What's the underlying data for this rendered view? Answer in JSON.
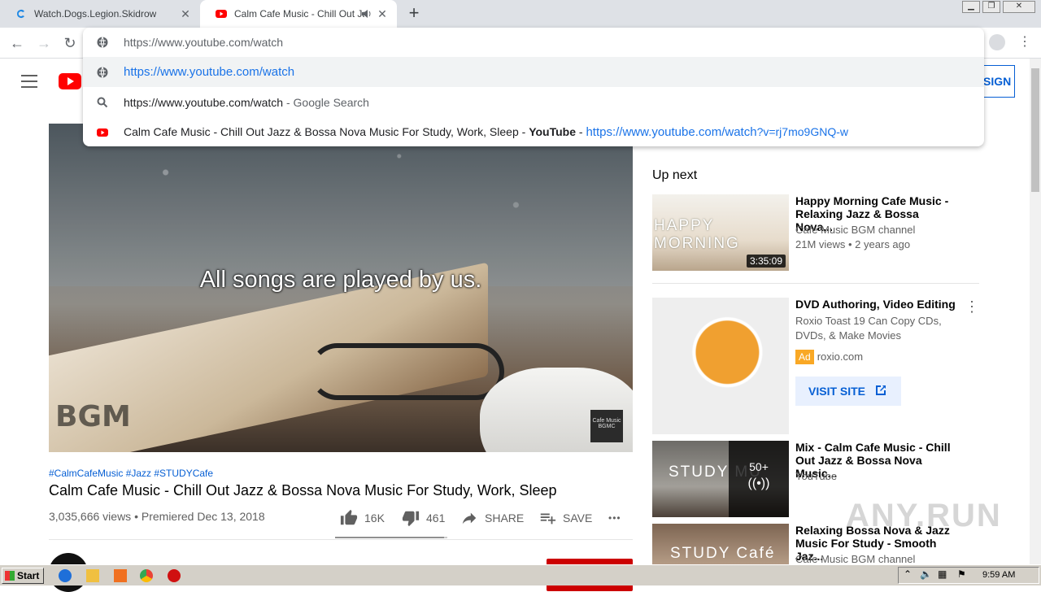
{
  "browser": {
    "tabs": [
      {
        "label": "Watch.Dogs.Legion.Skidrow",
        "favicon": "edge-download-icon"
      },
      {
        "label": "Calm Cafe Music - Chill Out Jazz & Bossa Nova Music For Study, Work, Sleep - YouTube",
        "favicon": "youtube-icon",
        "audio": "speaker-icon"
      }
    ],
    "address_typed": "https://www.youtube.com/watch",
    "suggestions": [
      {
        "text": "https://www.youtube.com/watch",
        "icon": "globe-icon"
      },
      {
        "text": "https://www.youtube.com/watch",
        "suffix": " - Google Search",
        "icon": "search-icon"
      },
      {
        "text": "Calm Cafe Music - Chill Out Jazz & Bossa Nova Music For Study, Work, Sleep - ",
        "bold": "YouTube",
        "sep": " - ",
        "url_prefix": "https://www.youtube.com/watch",
        "url_rest": "?v=rj7mo9GNQ-w",
        "icon": "youtube-icon"
      }
    ]
  },
  "youtube": {
    "signin_label": "SIGN IN",
    "video": {
      "caption": "All songs are played by us.",
      "watermark": "BGM",
      "corner_logo": "Cafe Music BGMC",
      "hashtags": "#CalmCafeMusic #Jazz #STUDYCafe",
      "title": "Calm Cafe Music - Chill Out Jazz & Bossa Nova Music For Study, Work, Sleep",
      "views": "3,035,666 views",
      "premiered": "• Premiered Dec 13, 2018",
      "likes": "16K",
      "dislikes": "461",
      "share_label": "SHARE",
      "save_label": "SAVE",
      "more_label": "•••",
      "like_ratio": 0.972
    },
    "sidebar": {
      "upnext_label": "Up next",
      "items": [
        {
          "title": "Happy Morning Cafe Music - Relaxing Jazz & Bossa Nova...",
          "channel": "Cafe Music BGM channel",
          "stats": "21M views • 2 years ago",
          "duration": "3:35:09",
          "thumb_text": "HAPPY MORNING"
        },
        {
          "title": "DVD Authoring, Video Editing",
          "line1": "Roxio Toast 19 Can Copy CDs,",
          "line2": "DVDs, & Make Movies",
          "ad_badge": "Ad",
          "domain": "roxio.com",
          "cta": "VISIT SITE"
        },
        {
          "title": "Mix - Calm Cafe Music - Chill Out Jazz & Bossa Nova Music...",
          "channel": "YouTube",
          "count": "50+",
          "thumb_text": "STUDY MU"
        },
        {
          "title": "Relaxing Bossa Nova & Jazz Music For Study - Smooth Jaz...",
          "channel": "Cafe Music BGM channel",
          "thumb_text": "STUDY Café"
        }
      ]
    }
  },
  "watermark": "ANY.RUN",
  "taskbar": {
    "start_label": "Start",
    "clock": "9:59 AM"
  },
  "colors": {
    "youtube_red": "#ff0000",
    "link_blue": "#065fd4",
    "chrome_blue": "#1a73e8"
  }
}
